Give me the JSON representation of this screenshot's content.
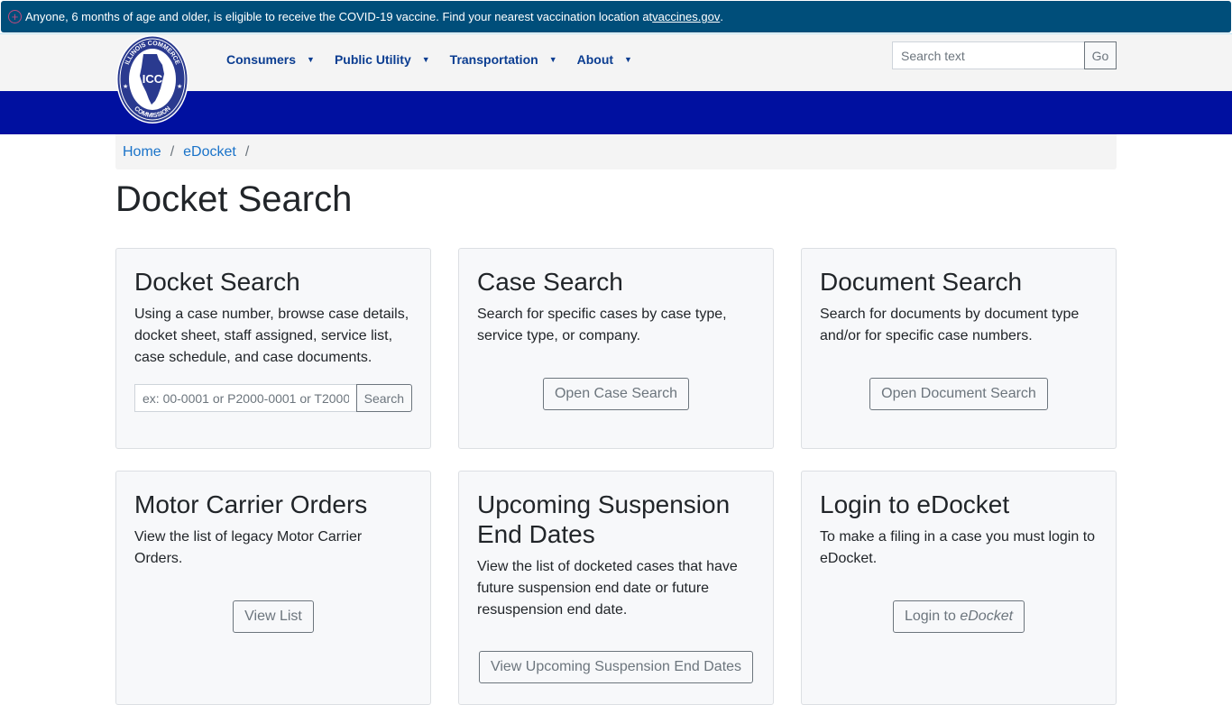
{
  "alert": {
    "icon": "plus-circle-icon",
    "text": "Anyone, 6 months of age and older, is eligible to receive the COVID-19 vaccine. Find your nearest vaccination location at ",
    "link_text": "vaccines.gov",
    "suffix": "."
  },
  "logo": {
    "top_text": "ILLINOIS COMMERCE",
    "center_text": "ICC",
    "bottom_text": "COMMISSION"
  },
  "nav": {
    "items": [
      {
        "label": "Consumers"
      },
      {
        "label": "Public Utility"
      },
      {
        "label": "Transportation"
      },
      {
        "label": "About"
      }
    ],
    "caret": "▼"
  },
  "search": {
    "placeholder": "Search text",
    "button_label": "Go"
  },
  "breadcrumb": {
    "items": [
      "Home",
      "eDocket"
    ],
    "separator": "/"
  },
  "page_title": "Docket Search",
  "cards": {
    "docket": {
      "title": "Docket Search",
      "text": "Using a case number, browse case details, docket sheet, staff assigned, service list, case schedule, and case documents.",
      "input_placeholder": "ex: 00-0001 or P2000-0001 or T2000",
      "button_label": "Search"
    },
    "case": {
      "title": "Case Search",
      "text": "Search for specific cases by case type, service type, or company.",
      "button_label": "Open Case Search"
    },
    "document": {
      "title": "Document Search",
      "text": "Search for documents by document type and/or for specific case numbers.",
      "button_label": "Open Document Search"
    },
    "motor": {
      "title": "Motor Carrier Orders",
      "text": "View the list of legacy Motor Carrier Orders.",
      "button_label": "View List"
    },
    "suspension": {
      "title": "Upcoming Suspension End Dates",
      "text": "View the list of docketed cases that have future suspension end date or future resuspension end date.",
      "button_label": "View Upcoming Suspension End Dates"
    },
    "login": {
      "title": "Login to eDocket",
      "text": "To make a filing in a case you must login to eDocket.",
      "button_label_prefix": "Login to ",
      "button_label_em": "eDocket"
    }
  }
}
